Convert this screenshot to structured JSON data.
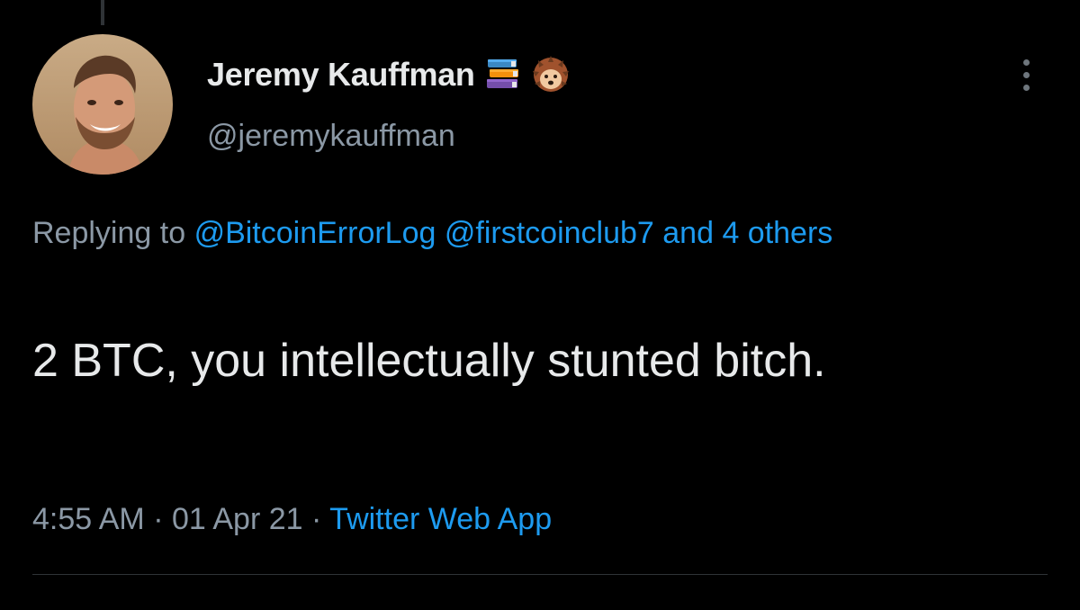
{
  "tweet": {
    "author": {
      "display_name": "Jeremy Kauffman",
      "handle": "@jeremykauffman",
      "name_emojis": [
        "books-emoji",
        "hedgehog-emoji"
      ]
    },
    "reply_context": {
      "prefix": "Replying to",
      "mentions": [
        "@BitcoinErrorLog",
        "@firstcoinclub7"
      ],
      "others": "and 4 others"
    },
    "text": "2 BTC, you intellectually stunted bitch.",
    "meta": {
      "time": "4:55 AM",
      "separator": "·",
      "date": "01 Apr 21",
      "source": "Twitter Web App"
    }
  },
  "colors": {
    "background": "#000000",
    "primary_text": "#e7e9ea",
    "secondary_text": "#8b98a5",
    "link": "#1d9bf0",
    "divider": "#2f3336"
  },
  "icons": {
    "more_menu": "more-vertical-icon"
  }
}
